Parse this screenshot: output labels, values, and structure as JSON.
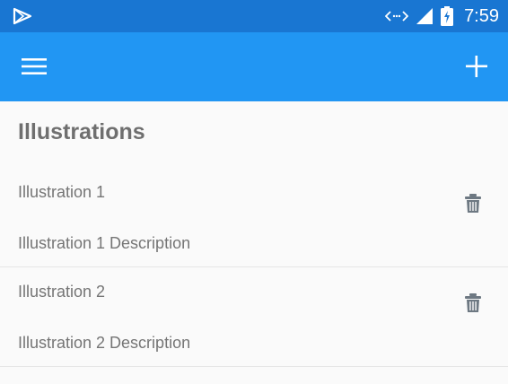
{
  "status_bar": {
    "time": "7:59",
    "icons": [
      "play-store-icon",
      "data-transfer-icon",
      "signal-icon",
      "battery-charging-icon"
    ],
    "background": "#1976d2"
  },
  "app_bar": {
    "background": "#2196f3",
    "menu_icon": "hamburger-menu-icon",
    "add_icon": "plus-icon"
  },
  "page": {
    "title": "Illustrations"
  },
  "illustrations": [
    {
      "title": "Illustration 1",
      "description": "Illustration 1 Description",
      "action_icon": "trash-icon"
    },
    {
      "title": "Illustration 2",
      "description": "Illustration 2 Description",
      "action_icon": "trash-icon"
    }
  ]
}
